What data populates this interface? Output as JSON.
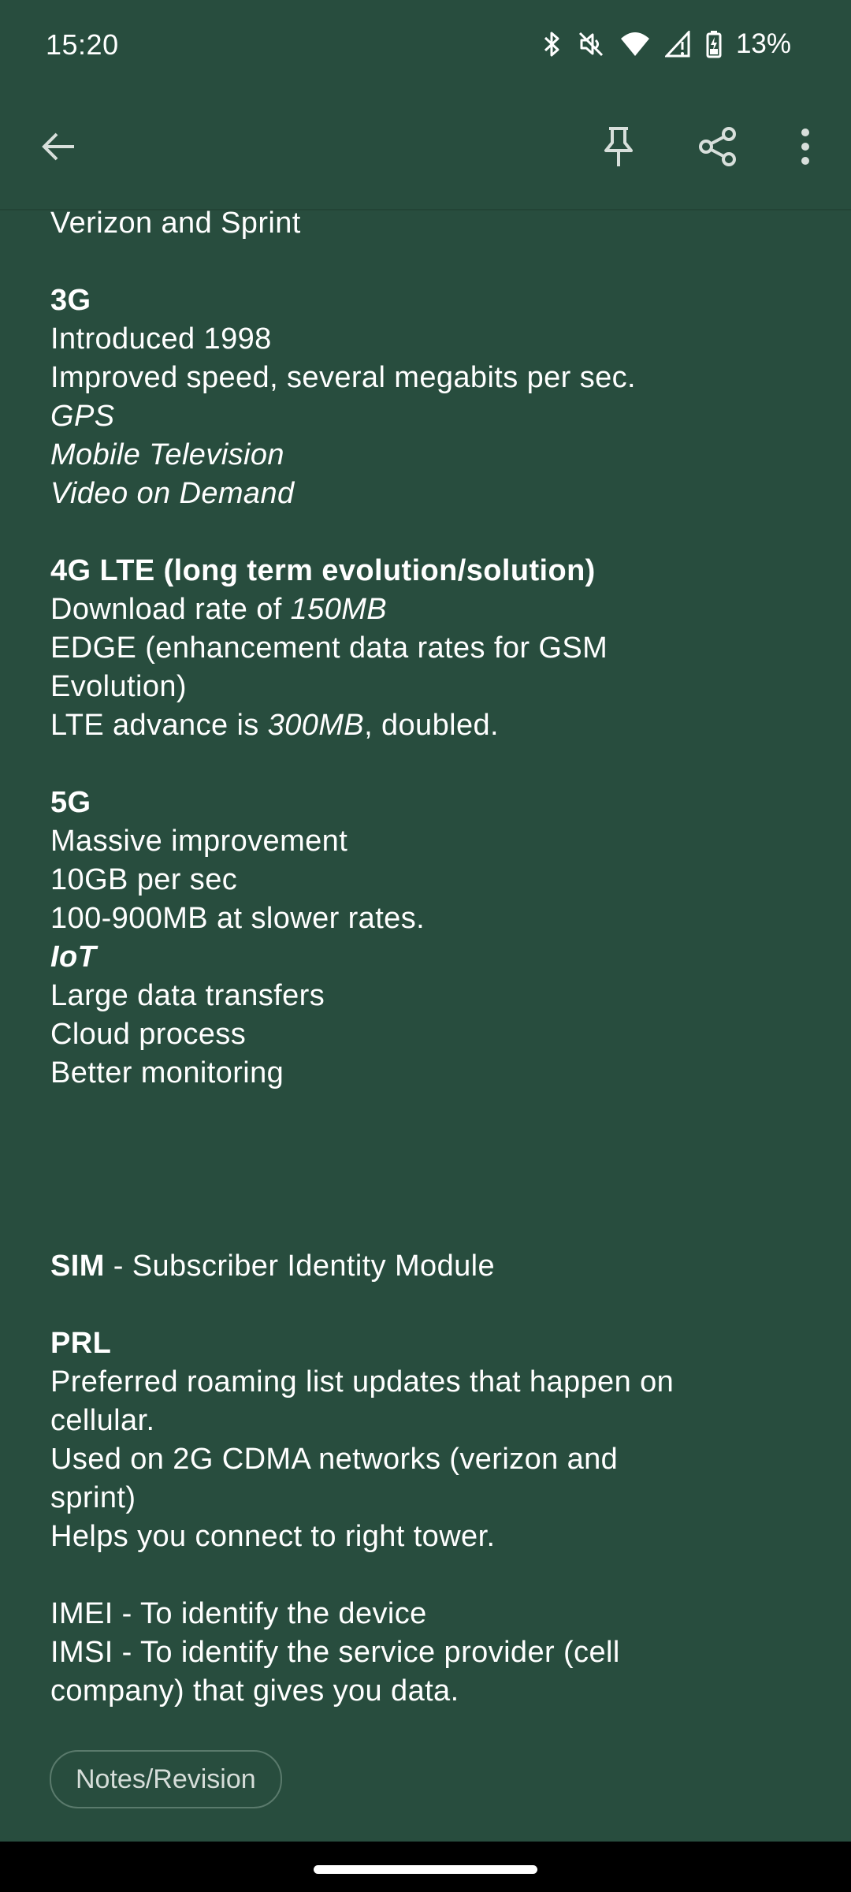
{
  "status_bar": {
    "time": "15:20",
    "battery": "13%",
    "icons": [
      "bluetooth-icon",
      "mute-icon",
      "wifi-icon",
      "signal-icon",
      "battery-charging-icon"
    ]
  },
  "toolbar": {
    "icons": [
      "back-arrow-icon",
      "pin-icon",
      "share-icon",
      "more-vertical-icon"
    ]
  },
  "note": {
    "lines": {
      "l1": "Verizon and Sprint",
      "l2": "3G",
      "l3": "Introduced 1998",
      "l4": "Improved speed, several megabits per sec.",
      "l5": "GPS",
      "l6": "Mobile Television",
      "l7": "Video on Demand",
      "l8": "4G LTE (long term evolution/solution)",
      "l9a": "Download rate of ",
      "l9b": "150MB",
      "l10": "EDGE (enhancement data rates for GSM",
      "l11": "Evolution)",
      "l12a": "LTE advance is ",
      "l12b": "300MB",
      "l12c": ", doubled.",
      "l13": "5G",
      "l14": "Massive improvement",
      "l15": "10GB per sec",
      "l16": "100-900MB at slower rates.",
      "l17": "IoT",
      "l18": "Large data transfers",
      "l19": "Cloud process",
      "l20": "Better monitoring",
      "l21a": "SIM",
      "l21b": " - Subscriber Identity Module",
      "l22": "PRL",
      "l23": "Preferred roaming list updates that happen on",
      "l24": "cellular.",
      "l25": "Used on 2G CDMA networks (verizon and",
      "l26": "sprint)",
      "l27": "Helps you connect to right tower.",
      "l28": "IMEI - To identify the device",
      "l29": "IMSI - To identify the service provider (cell",
      "l30": "company) that gives you data."
    }
  },
  "chip": {
    "label": "Notes/Revision"
  },
  "colors": {
    "background": "#284d3e",
    "text": "#ffffff",
    "chip_border": "#5a7a6c"
  }
}
